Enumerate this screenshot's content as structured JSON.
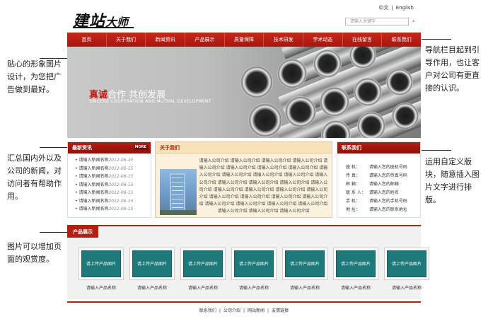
{
  "annotations": {
    "left": [
      "贴心的形象图片设计，为您把广告做到最好。",
      "汇总国内外以及公司的新闻，对访问者有帮助作用。",
      "图片可以增加页面的观赏度。"
    ],
    "right": [
      "导航栏目起到引导作用，也让客户对公司有更直接的认识。",
      "运用自定义版块，随意插入图片文字进行排版。"
    ]
  },
  "header": {
    "logo_main": "建站",
    "logo_sub": "大师",
    "lang_cn": "中文",
    "lang_en": "English",
    "search_placeholder": "请输入关键字"
  },
  "nav": [
    "首页",
    "关于我们",
    "新闻资讯",
    "产品展示",
    "质量保障",
    "技术研发",
    "学术动态",
    "在线留言",
    "联系我们"
  ],
  "banner": {
    "title_red": "真诚",
    "title_rest": "合作   共创发展",
    "subtitle": "SINCERE COOPERATION AND MUTUAL DEVELOPMENT"
  },
  "news": {
    "title": "最新资讯",
    "more": "MORE",
    "items": [
      {
        "title": "请输入新闻名称",
        "date": "2012-06-15"
      },
      {
        "title": "请输入新闻名称",
        "date": "2012-06-15"
      },
      {
        "title": "请输入新闻名称",
        "date": "2012-06-15"
      },
      {
        "title": "请输入新闻名称",
        "date": "2012-06-15"
      },
      {
        "title": "请输入新闻名称",
        "date": "2012-06-15"
      },
      {
        "title": "请输入新闻名称",
        "date": "2012-06-15"
      },
      {
        "title": "请输入新闻名称",
        "date": "2012-06-15"
      }
    ]
  },
  "about": {
    "title": "关于我们",
    "text": "请输入公司介绍 请输入公司介绍 请输入公司介绍 请输入公司介绍 请输入公司介绍 请输入公司介绍 请输入公司介绍 请输入公司介绍 请输入公司介绍 请输入公司介绍 请输入公司介绍 请输入公司介绍 请输入公司介绍 请输入公司介绍 请输入公司介绍 请输入公司介绍 请输入公司介绍 请输入公司介绍 请输入公司介绍 请输入公司介绍 请输入公司介绍 请输入公司介绍 请输入公司介绍 请输入公司介绍 请输入公司介绍 请输入公司介绍 请输入公司介绍 请输入公司介绍 请输入公司介绍 请输入公司介绍 请输入公司介绍 请输入公司介绍"
  },
  "contact": {
    "title": "联系我们",
    "rows": [
      {
        "k": "座 机：",
        "v": "请输入您的座机号码"
      },
      {
        "k": "传 真：",
        "v": "请输入您的传真号码"
      },
      {
        "k": "邮 箱：",
        "v": "请输入您的邮箱"
      },
      {
        "k": "联 系 人：",
        "v": "请输入您的姓名"
      },
      {
        "k": "手 机：",
        "v": "请输入您的手机号码"
      },
      {
        "k": "地 址：",
        "v": "请输入您的联系地址"
      }
    ]
  },
  "products": {
    "title": "产品展示",
    "placeholder": "请上传产品图片",
    "items": [
      "请输入产品名称",
      "请输入产品名称",
      "请输入产品名称",
      "请输入产品名称",
      "请输入产品名称",
      "请输入产品名称",
      "请输入产品名称"
    ]
  },
  "footer": [
    "联系我们",
    "公司介绍",
    "网站新闻",
    "友情链接"
  ]
}
